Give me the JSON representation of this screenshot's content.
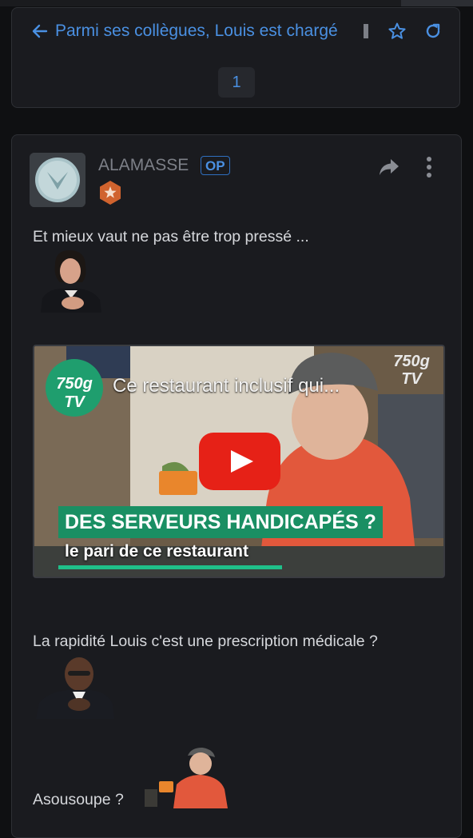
{
  "header": {
    "title": "Parmi ses collègues, Louis est chargé",
    "page_number": "1"
  },
  "post": {
    "username": "ALAMASSE",
    "op_badge": "OP",
    "paragraphs": [
      "Et mieux vaut ne pas être trop pressé ...",
      "La rapidité Louis c'est une prescription médicale ?",
      "Asousoupe ?"
    ],
    "video": {
      "title": "Ce restaurant inclusif qui...",
      "channel_badge": "750g TV",
      "logo_text": "750g TV",
      "banner_headline": "DES SERVEURS HANDICAPÉS ?",
      "banner_subline": "le pari de ce restaurant",
      "accent_color": "#1a8f63",
      "play_color": "#e62117"
    }
  },
  "colors": {
    "link_blue": "#4a90e2",
    "background": "#0f1012",
    "card": "#1a1b1f"
  }
}
